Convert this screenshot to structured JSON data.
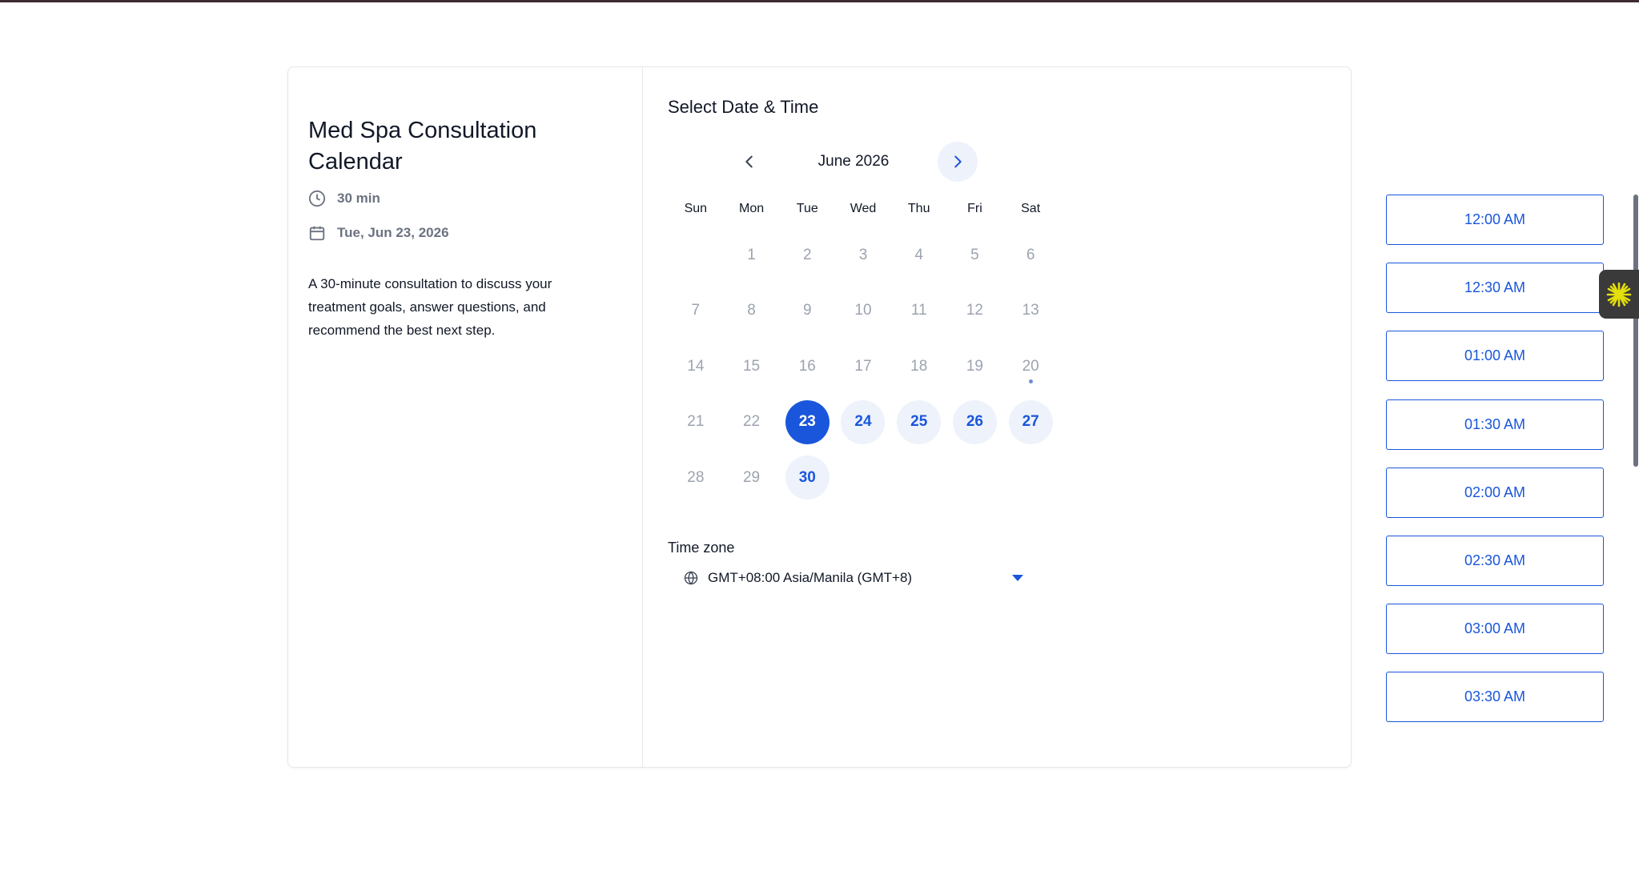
{
  "event": {
    "title": "Med Spa Consultation Calendar",
    "duration": "30 min",
    "date": "Tue, Jun 23, 2026",
    "description": "A 30-minute consultation to discuss your treatment goals, answer questions, and recommend the best next step."
  },
  "scheduler": {
    "section_title": "Select Date & Time",
    "month_label": "June 2026",
    "weekdays": [
      "Sun",
      "Mon",
      "Tue",
      "Wed",
      "Thu",
      "Fri",
      "Sat"
    ],
    "start_offset": 1,
    "days": [
      {
        "n": "1",
        "state": "disabled"
      },
      {
        "n": "2",
        "state": "disabled"
      },
      {
        "n": "3",
        "state": "disabled"
      },
      {
        "n": "4",
        "state": "disabled"
      },
      {
        "n": "5",
        "state": "disabled"
      },
      {
        "n": "6",
        "state": "disabled"
      },
      {
        "n": "7",
        "state": "disabled"
      },
      {
        "n": "8",
        "state": "disabled"
      },
      {
        "n": "9",
        "state": "disabled"
      },
      {
        "n": "10",
        "state": "disabled"
      },
      {
        "n": "11",
        "state": "disabled"
      },
      {
        "n": "12",
        "state": "disabled"
      },
      {
        "n": "13",
        "state": "disabled"
      },
      {
        "n": "14",
        "state": "disabled"
      },
      {
        "n": "15",
        "state": "disabled"
      },
      {
        "n": "16",
        "state": "disabled"
      },
      {
        "n": "17",
        "state": "disabled"
      },
      {
        "n": "18",
        "state": "disabled"
      },
      {
        "n": "19",
        "state": "disabled"
      },
      {
        "n": "20",
        "state": "today"
      },
      {
        "n": "21",
        "state": "disabled"
      },
      {
        "n": "22",
        "state": "disabled"
      },
      {
        "n": "23",
        "state": "selected"
      },
      {
        "n": "24",
        "state": "available"
      },
      {
        "n": "25",
        "state": "available"
      },
      {
        "n": "26",
        "state": "available"
      },
      {
        "n": "27",
        "state": "available"
      },
      {
        "n": "28",
        "state": "disabled"
      },
      {
        "n": "29",
        "state": "disabled"
      },
      {
        "n": "30",
        "state": "available"
      }
    ],
    "timezone_label": "Time zone",
    "timezone_value": "GMT+08:00 Asia/Manila (GMT+8)",
    "time_slots": [
      "12:00 AM",
      "12:30 AM",
      "01:00 AM",
      "01:30 AM",
      "02:00 AM",
      "02:30 AM",
      "03:00 AM",
      "03:30 AM"
    ]
  },
  "colors": {
    "accent": "#1a56db",
    "available_bg": "#eef2fb",
    "muted_text": "#9ca3af",
    "widget_icon": "#e5e00b"
  },
  "icons": {
    "duration": "clock-icon",
    "date": "calendar-icon",
    "prev": "chevron-left-icon",
    "next": "chevron-right-icon",
    "timezone": "globe-icon",
    "timezone_caret": "caret-down-icon",
    "widget": "sparkle-icon"
  }
}
